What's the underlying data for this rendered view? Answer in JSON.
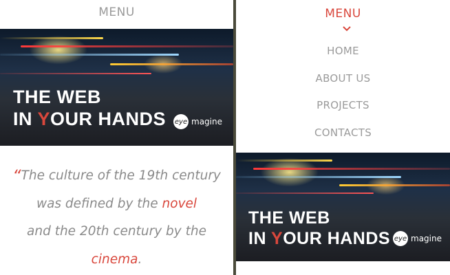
{
  "left": {
    "menu_label": "MENU",
    "hero": {
      "title_line1": "THE WEB",
      "title_line2_pre": "IN ",
      "title_line2_accent": "Y",
      "title_line2_post": "OUR HANDS",
      "logo_badge": "eye",
      "logo_text": "magine"
    },
    "quote": {
      "mark": "“",
      "line1": "The culture of the 19th century",
      "line2_pre": "was defined by the ",
      "line2_red": "novel",
      "line3": "and the 20th century by the",
      "line4_red": "cinema",
      "line4_post": "."
    }
  },
  "right": {
    "menu_label": "MENU",
    "nav_items": [
      "HOME",
      "ABOUT US",
      "PROJECTS",
      "CONTACTS"
    ],
    "hero": {
      "title_line1": "THE WEB",
      "title_line2_pre": "IN ",
      "title_line2_accent": "Y",
      "title_line2_post": "OUR HANDS",
      "logo_badge": "eye",
      "logo_text": "magine"
    }
  },
  "colors": {
    "accent": "#d9473c",
    "muted_text": "#9a9a9a",
    "divider": "#4a4a3a"
  },
  "icons": {
    "menu_open": "chevron-down-icon"
  }
}
